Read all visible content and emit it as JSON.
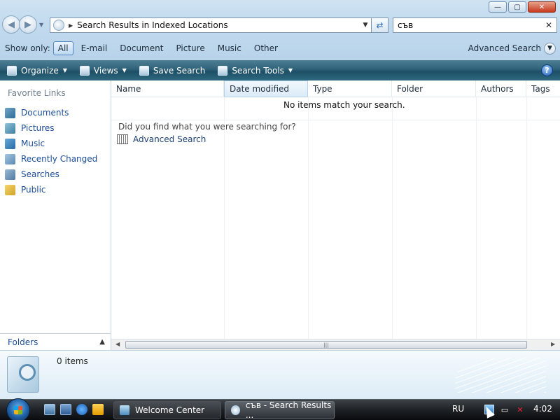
{
  "window": {
    "buttons": {
      "minimize": "—",
      "maximize": "▢",
      "close": "✕"
    }
  },
  "address": {
    "breadcrumb": "Search Results in Indexed Locations"
  },
  "search": {
    "value": "съв"
  },
  "filter": {
    "label": "Show only:",
    "options": [
      "All",
      "E-mail",
      "Document",
      "Picture",
      "Music",
      "Other"
    ],
    "active": "All",
    "advanced_label": "Advanced Search"
  },
  "toolbar": {
    "organize": "Organize",
    "views": "Views",
    "save_search": "Save Search",
    "search_tools": "Search Tools",
    "help": "?"
  },
  "nav": {
    "heading": "Favorite Links",
    "items": [
      {
        "label": "Documents",
        "icon": "documents-icon"
      },
      {
        "label": "Pictures",
        "icon": "pictures-icon"
      },
      {
        "label": "Music",
        "icon": "music-icon"
      },
      {
        "label": "Recently Changed",
        "icon": "recently-changed-icon"
      },
      {
        "label": "Searches",
        "icon": "searches-icon"
      },
      {
        "label": "Public",
        "icon": "public-folder-icon"
      }
    ],
    "folders_label": "Folders"
  },
  "columns": [
    "Name",
    "Date modified",
    "Type",
    "Folder",
    "Authors",
    "Tags"
  ],
  "content": {
    "empty_message": "No items match your search.",
    "did_you_find": "Did you find what you were searching for?",
    "advanced_link": "Advanced Search"
  },
  "details": {
    "item_count": "0 items"
  },
  "taskbar": {
    "tasks": [
      {
        "label": "Welcome Center"
      },
      {
        "label": "съв - Search Results ..."
      }
    ],
    "language": "RU",
    "clock": "4:02"
  },
  "colors": {
    "command_bar": "#2f6278",
    "link": "#1b4d99",
    "taskbar": "#1e2226"
  }
}
